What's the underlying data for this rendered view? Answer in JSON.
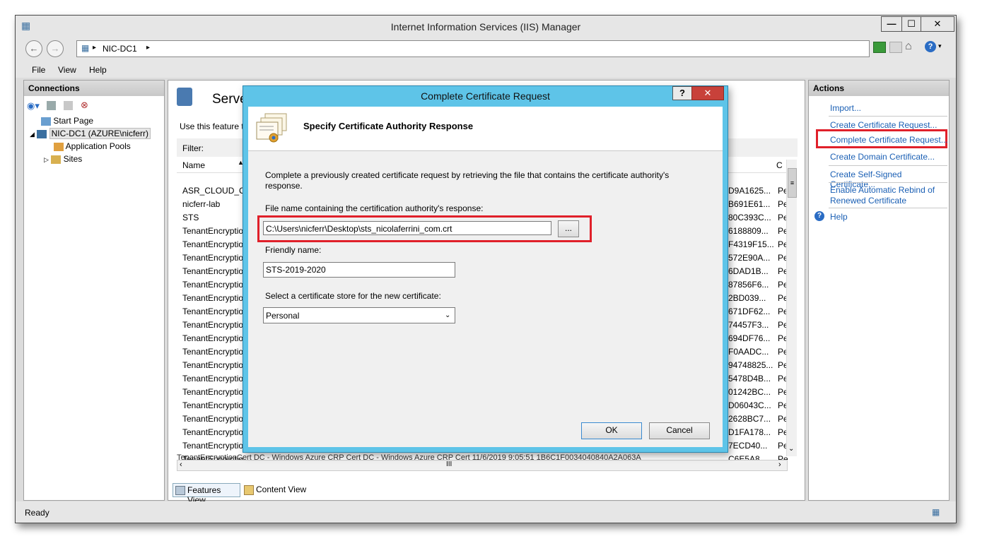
{
  "window": {
    "title": "Internet Information Services (IIS) Manager",
    "min_glyph": "—",
    "max_glyph": "☐",
    "close_glyph": "✕"
  },
  "address": {
    "crumb": "NIC-DC1",
    "arrow": "▸"
  },
  "menu": {
    "file": "File",
    "view": "View",
    "help": "Help"
  },
  "connections": {
    "header": "Connections",
    "tree": [
      {
        "label": "Start Page"
      },
      {
        "label": "NIC-DC1 (AZURE\\nicferr)"
      },
      {
        "label": "Application Pools"
      },
      {
        "label": "Sites"
      }
    ]
  },
  "center": {
    "title": "Serve",
    "description": "Use this feature t",
    "filter_label": "Filter:",
    "col_name": "Name",
    "col_c": "C",
    "tabs": {
      "features": "Features View",
      "content": "Content View"
    },
    "rows": [
      {
        "name": "ASR_CLOUD_CEI",
        "hash": "D9A1625...",
        "c": "Pe"
      },
      {
        "name": "nicferr-lab",
        "hash": "B691E61...",
        "c": "Pe"
      },
      {
        "name": "STS",
        "hash": "80C393C...",
        "c": "Pe"
      },
      {
        "name": "TenantEncryptio",
        "hash": "6188809...",
        "c": "Pe"
      },
      {
        "name": "TenantEncryptio",
        "hash": "F4319F15...",
        "c": "Pe"
      },
      {
        "name": "TenantEncryptio",
        "hash": "572E90A...",
        "c": "Pe"
      },
      {
        "name": "TenantEncryptio",
        "hash": "6DAD1B...",
        "c": "Pe"
      },
      {
        "name": "TenantEncryptio",
        "hash": "87856F6...",
        "c": "Pe"
      },
      {
        "name": "TenantEncryptio",
        "hash": "2BD039...",
        "c": "Pe"
      },
      {
        "name": "TenantEncryptio",
        "hash": "671DF62...",
        "c": "Pe"
      },
      {
        "name": "TenantEncryptio",
        "hash": "74457F3...",
        "c": "Pe"
      },
      {
        "name": "TenantEncryptio",
        "hash": "694DF76...",
        "c": "Pe"
      },
      {
        "name": "TenantEncryptio",
        "hash": "F0AADC...",
        "c": "Pe"
      },
      {
        "name": "TenantEncryptio",
        "hash": "94748825...",
        "c": "Pe"
      },
      {
        "name": "TenantEncryptio",
        "hash": "5478D4B...",
        "c": "Pe"
      },
      {
        "name": "TenantEncryptio",
        "hash": "01242BC...",
        "c": "Pe"
      },
      {
        "name": "TenantEncryptio",
        "hash": "D06043C...",
        "c": "Pe"
      },
      {
        "name": "TenantEncryptio",
        "hash": "2628BC7...",
        "c": "Pe"
      },
      {
        "name": "TenantEncryptio",
        "hash": "D1FA178...",
        "c": "Pe"
      },
      {
        "name": "TenantEncryptio",
        "hash": "7ECD40...",
        "c": "Pe"
      },
      {
        "name": "TenantEncryptio",
        "hash": "C6E5A8...",
        "c": "Pe"
      }
    ],
    "partial_row": "TenantEncryptionCert      DC - Windows Azure CRP Cert      DC - Windows Azure CRP Cert      11/6/2019 9:05:51      1B6C1F0034040840A2A063A",
    "hscroll_thumb": "III"
  },
  "actions": {
    "header": "Actions",
    "import": "Import...",
    "create_request": "Create Certificate Request...",
    "complete_request": "Complete Certificate Request...",
    "create_domain": "Create Domain Certificate...",
    "create_self_signed": "Create Self-Signed Certificate...",
    "enable_rebind_1": "Enable Automatic Rebind of",
    "enable_rebind_2": "Renewed Certificate",
    "help": "Help"
  },
  "status": {
    "text": "Ready"
  },
  "dialog": {
    "title": "Complete Certificate Request",
    "help_glyph": "?",
    "close_glyph": "✕",
    "heading": "Specify Certificate Authority Response",
    "intro": "Complete a previously created certificate request by retrieving the file that contains the certificate authority's response.",
    "file_label": "File name containing the certification authority's response:",
    "file_value": "C:\\Users\\nicferr\\Desktop\\sts_nicolaferrini_com.crt",
    "browse_label": "...",
    "friendly_label": "Friendly name:",
    "friendly_value": "STS-2019-2020",
    "store_label": "Select a certificate store for the new certificate:",
    "store_value": "Personal",
    "ok": "OK",
    "cancel": "Cancel"
  },
  "colors": {
    "highlight": "#e0202a",
    "dialog_frame": "#5ec4e8",
    "link": "#1a5fb4"
  }
}
